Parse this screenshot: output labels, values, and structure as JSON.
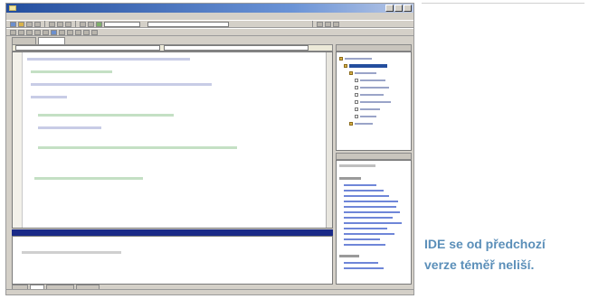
{
  "caption": {
    "line1": "IDE se od předchozí",
    "line2": "verze téměř  neliší."
  },
  "colors": {
    "caption": "#5b8fb9",
    "titlebar": "#244e9e",
    "output_title": "#1a2a88",
    "code_keyword": "#1a1a99",
    "code_comment": "#2d8a2d",
    "link": "#1a3cc8"
  },
  "icons": [
    "app-icon",
    "minimize-icon",
    "maximize-icon",
    "close-icon",
    "folder-icon",
    "file-icon"
  ]
}
